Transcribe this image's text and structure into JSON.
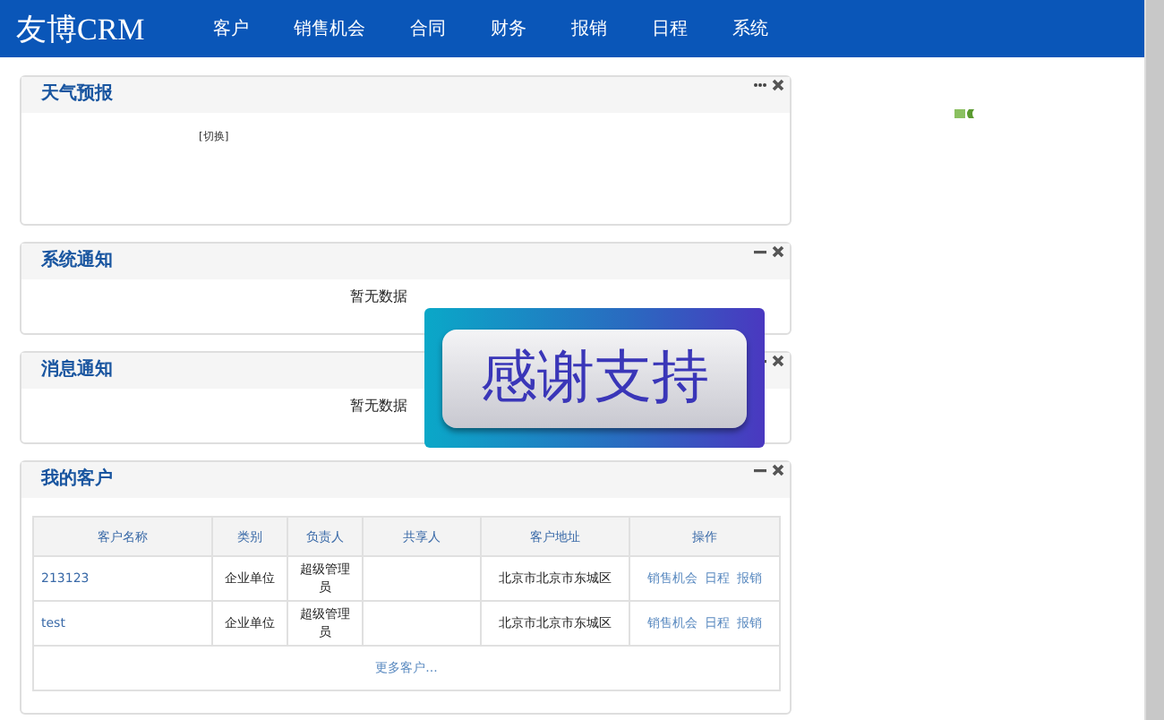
{
  "header": {
    "logo": "友博CRM",
    "nav": [
      {
        "label": "客户"
      },
      {
        "label": "销售机会"
      },
      {
        "label": "合同"
      },
      {
        "label": "财务"
      },
      {
        "label": "报销"
      },
      {
        "label": "日程"
      },
      {
        "label": "系统"
      }
    ]
  },
  "panels": [
    {
      "kind": "weather",
      "title": "天气预报",
      "switch_link": "[切换]"
    },
    {
      "kind": "notice",
      "title": "系统通知",
      "empty_text": "暂无数据"
    },
    {
      "kind": "notice",
      "title": "消息通知",
      "empty_text": "暂无数据"
    },
    {
      "kind": "customers",
      "title": "我的客户",
      "table": {
        "columns": [
          "客户名称",
          "类别",
          "负责人",
          "共享人",
          "客户地址",
          "操作"
        ],
        "rows": [
          {
            "name": "213123",
            "category": "企业单位",
            "owner": "超级管理员",
            "sharer": "",
            "address": "北京市北京市东城区",
            "actions": [
              "销售机会",
              "日程",
              "报销"
            ]
          },
          {
            "name": "test",
            "category": "企业单位",
            "owner": "超级管理员",
            "sharer": "",
            "address": "北京市北京市东城区",
            "actions": [
              "销售机会",
              "日程",
              "报销"
            ]
          }
        ],
        "more_link": "更多客户..."
      }
    }
  ],
  "overlay": {
    "text": "感谢支持"
  }
}
